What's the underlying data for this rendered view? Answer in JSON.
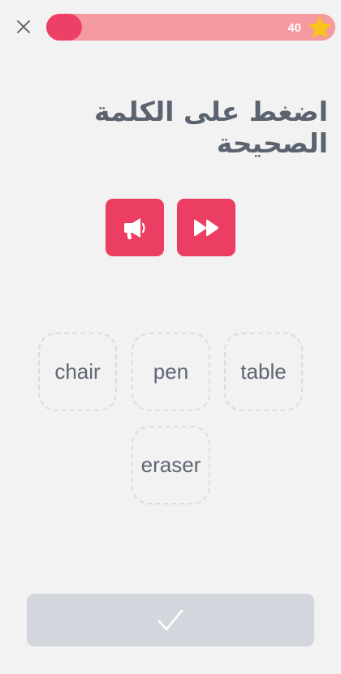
{
  "header": {
    "close_icon": "close-icon",
    "progress_fraction": 0.12,
    "score": "40",
    "star_icon": "star-icon",
    "colors": {
      "progress_fill": "#ee3f66",
      "progress_track": "#f59a9e",
      "star": "#f7c21a"
    }
  },
  "prompt": {
    "instruction": "اضغط على الكلمة الصحيحة"
  },
  "audio": {
    "play_icon": "megaphone-icon",
    "fast_icon": "fast-forward-icon",
    "button_color": "#ec3d63"
  },
  "words": [
    "chair",
    "pen",
    "table",
    "eraser"
  ],
  "footer": {
    "check_icon": "checkmark-icon",
    "button_color": "#d3d6dc"
  }
}
